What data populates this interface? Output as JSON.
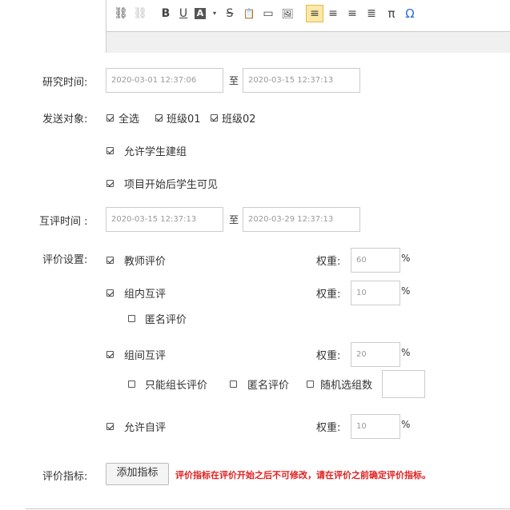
{
  "toolbar": {
    "items": [
      {
        "name": "link-icon",
        "glyph": "⛓"
      },
      {
        "name": "unlink-icon",
        "glyph": "⛓"
      },
      {
        "name": "bold-icon",
        "glyph": "B"
      },
      {
        "name": "underline-icon",
        "glyph": "U"
      },
      {
        "name": "font-color-icon",
        "glyph": "A"
      },
      {
        "name": "strikethrough-icon",
        "glyph": "S"
      },
      {
        "name": "paste-text-icon",
        "glyph": "📋"
      },
      {
        "name": "toggle-icon",
        "glyph": "▭"
      },
      {
        "name": "image-icon",
        "glyph": "🖼"
      },
      {
        "name": "align-left-icon",
        "glyph": "≡"
      },
      {
        "name": "align-center-icon",
        "glyph": "≡"
      },
      {
        "name": "align-right-icon",
        "glyph": "≡"
      },
      {
        "name": "align-justify-icon",
        "glyph": "≣"
      },
      {
        "name": "pi-icon",
        "glyph": "π"
      },
      {
        "name": "omega-icon",
        "glyph": "Ω"
      }
    ]
  },
  "research_time": {
    "label": "研究时间:",
    "start": "2020-03-01 12:37:06",
    "sep": "至",
    "end": "2020-03-15 12:37:13"
  },
  "send_target": {
    "label": "发送对象:",
    "options": [
      {
        "label": "全选",
        "checked": true
      },
      {
        "label": "班级01",
        "checked": true
      },
      {
        "label": "班级02",
        "checked": true
      }
    ]
  },
  "allow_group": {
    "label": "允许学生建组",
    "checked": true
  },
  "visible_after_start": {
    "label": "项目开始后学生可见",
    "checked": true
  },
  "peer_time": {
    "label": "互评时间 :",
    "start": "2020-03-15 12:37:13",
    "sep": "至",
    "end": "2020-03-29 12:37:13"
  },
  "eval_settings": {
    "label": "评价设置:",
    "weight_label": "权重:",
    "pct": "%",
    "teacher": {
      "label": "教师评价",
      "checked": true,
      "weight": "60"
    },
    "intra": {
      "label": "组内互评",
      "checked": true,
      "weight": "10",
      "anonymous": {
        "label": "匿名评价",
        "checked": false
      }
    },
    "inter": {
      "label": "组间互评",
      "checked": true,
      "weight": "20",
      "leader_only": {
        "label": "只能组长评价",
        "checked": false
      },
      "anonymous": {
        "label": "匿名评价",
        "checked": false
      },
      "random_groups": {
        "label": "随机选组数",
        "checked": false,
        "value": ""
      }
    },
    "self": {
      "label": "允许自评",
      "checked": true,
      "weight": "10"
    }
  },
  "eval_index": {
    "label": "评价指标:",
    "button": "添加指标",
    "warning": "评价指标在评价开始之后不可修改，请在评价之前确定评价指标。"
  }
}
